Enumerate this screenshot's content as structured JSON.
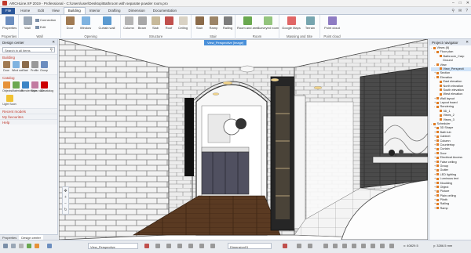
{
  "window": {
    "title": "ARCHLine.XP 2019 - Professional - C:\\Users\\user\\Desktop\\Bathroom with separate powder room.pro",
    "minimize": "–",
    "maximize": "□",
    "close": "✕"
  },
  "tabs": [
    "File",
    "Home",
    "Edit",
    "View",
    "Building",
    "Interior",
    "Drafting",
    "Dimension",
    "Documentation"
  ],
  "active_tab": "Building",
  "ribbon": {
    "groups": {
      "properties": "Properties",
      "wall": "Wall",
      "opening": "Opening",
      "structure": "Structure",
      "stair": "Stair",
      "room": "Room",
      "massing": "Massing and Site",
      "pointcloud": "Point cloud"
    },
    "buttons": {
      "properties": "Properties",
      "wall": "Wall",
      "connection": "Connection",
      "edit": "Edit",
      "door": "Door",
      "window": "Window",
      "curtain_wall": "Curtain wall",
      "column": "Column",
      "beam": "Beam",
      "slab": "Slab",
      "roof": "Roof",
      "ceiling": "Ceiling",
      "stair": "Stair",
      "ramp": "Ramp",
      "railing": "Railing",
      "room_area": "Room and area",
      "surveyed_room": "Surveyed room",
      "google_maps": "Google Maps",
      "terrain": "Terrain",
      "point_cloud": "Point cloud"
    }
  },
  "design_center": {
    "title": "Design center",
    "search_placeholder": "Search in all items",
    "building": {
      "heading": "Building",
      "items": [
        "Door",
        "Wind ow",
        "Stair",
        "Profile",
        "Group"
      ]
    },
    "catalog": {
      "heading": "Catalog",
      "items": [
        "Objects",
        "Materials",
        "Render style",
        "Show room",
        "3D catalog"
      ],
      "extra": "Light Soon"
    },
    "links": [
      "Recent models",
      "My favourites",
      "Help"
    ],
    "bottom_tabs": [
      "Properties",
      "Design center"
    ]
  },
  "viewport": {
    "tab_label": "View_Perspective [Image]"
  },
  "project_navigator": {
    "title": "Project navigator",
    "items": [
      "Views (6)",
      "Floor plan",
      "Bathroom_Carp",
      "Ground",
      "View",
      "View_Perspecti",
      "Section",
      "Elevation",
      "East elevation",
      "North elevation",
      "South elevation",
      "West elevation",
      "Wall layout",
      "Layout board",
      "Rendering",
      "3D_1",
      "Views_2",
      "Views_3",
      "Scheduler",
      "3D Shape",
      "Bath tub",
      "Cabinet",
      "Column",
      "Countertop",
      "Curtain",
      "Door",
      "Electrical Access",
      "False ceiling",
      "Group",
      "Gutter",
      "LED lighting",
      "Luminous text",
      "Moulding",
      "Object",
      "Picture",
      "Plain ceiling",
      "Plinth",
      "Railing",
      "Ramp"
    ],
    "selected": "View_Perspecti"
  },
  "status": {
    "view_name": "View_Perspective",
    "dimension": "Dimension01",
    "coord_x": "x: 40829.5",
    "coord_y": "y: 3286.5 mm"
  },
  "colors": {
    "accent": "#2b579a",
    "section_red": "#c0392b",
    "view_tab": "#4a90d9"
  }
}
